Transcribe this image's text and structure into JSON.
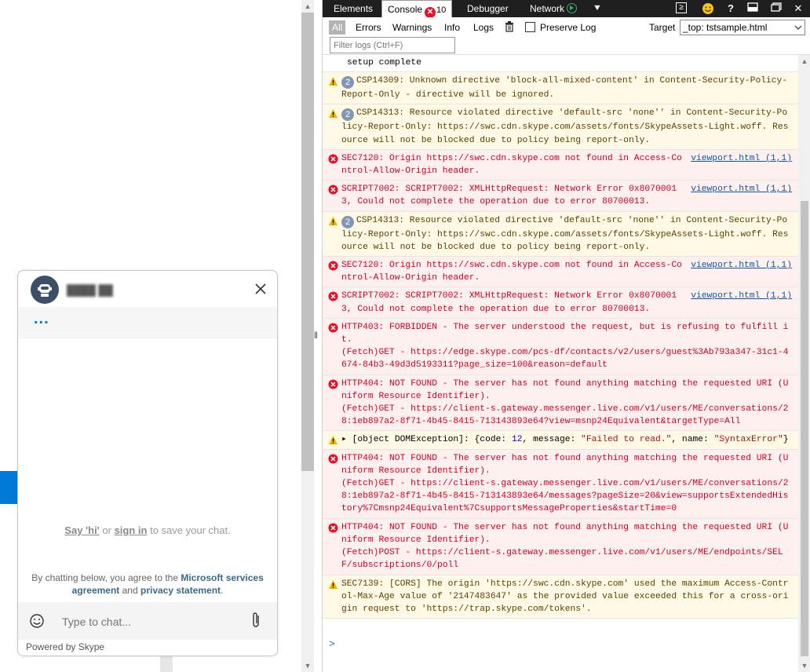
{
  "chat": {
    "name": "████ ██",
    "typing_indicator": "...",
    "say_hi": "Say 'hi'",
    "or": " or ",
    "sign_in": "sign in",
    "save_suffix": " to save your chat.",
    "agree_prefix": "By chatting below, you agree to the ",
    "agreement_link": "Microsoft services agreement",
    "and": " and ",
    "privacy_link": "privacy statement",
    "period": ".",
    "input_placeholder": "Type to chat...",
    "powered_by": "Powered by Skype"
  },
  "devtools": {
    "tabs": {
      "elements": "Elements",
      "console": "Console",
      "error_count": "10",
      "debugger": "Debugger",
      "network": "Network"
    },
    "filters": [
      "All",
      "Errors",
      "Warnings",
      "Info",
      "Logs"
    ],
    "preserve_log": "Preserve Log",
    "target_label": "Target",
    "target_value": "_top: tstsample.html",
    "filter_placeholder": "Filter logs (Ctrl+F)"
  },
  "console": {
    "first_line": "setup complete",
    "messages": [
      {
        "level": "warn",
        "count": "2",
        "text": "CSP14309: Unknown directive 'block-all-mixed-content' in Content-Security-Policy-Report-Only - directive will be ignored.",
        "source": ""
      },
      {
        "level": "warn",
        "count": "2",
        "text": "CSP14313: Resource violated directive 'default-src 'none'' in Content-Security-Policy-Report-Only: https://swc.cdn.skype.com/assets/fonts/SkypeAssets-Light.woff. Resource will not be blocked due to policy being report-only.",
        "source": ""
      },
      {
        "level": "err",
        "count": "",
        "text": "SEC7120: Origin https://swc.cdn.skype.com not found in Access-Control-Allow-Origin header.",
        "source": "viewport.html (1,1)"
      },
      {
        "level": "err",
        "count": "",
        "text": "SCRIPT7002: SCRIPT7002: XMLHttpRequest: Network Error 0x80700013, Could not complete the operation due to error 80700013.",
        "source": "viewport.html (1,1)"
      },
      {
        "level": "warn",
        "count": "2",
        "text": "CSP14313: Resource violated directive 'default-src 'none'' in Content-Security-Policy-Report-Only: https://swc.cdn.skype.com/assets/fonts/SkypeAssets-Light.woff. Resource will not be blocked due to policy being report-only.",
        "source": ""
      },
      {
        "level": "err",
        "count": "",
        "text": "SEC7120: Origin https://swc.cdn.skype.com not found in Access-Control-Allow-Origin header.",
        "source": "viewport.html (1,1)"
      },
      {
        "level": "err",
        "count": "",
        "text": "SCRIPT7002: SCRIPT7002: XMLHttpRequest: Network Error 0x80700013, Could not complete the operation due to error 80700013.",
        "source": "viewport.html (1,1)"
      },
      {
        "level": "err",
        "count": "",
        "text": "HTTP403: FORBIDDEN - The server understood the request, but is refusing to fulfill it.\n(Fetch)GET - https://edge.skype.com/pcs-df/contacts/v2/users/guest%3Ab793a347-31c1-4674-84b3-49d3d5193311?page_size=100&reason=default",
        "source": ""
      },
      {
        "level": "err",
        "count": "",
        "text": "HTTP404: NOT FOUND - The server has not found anything matching the requested URI (Uniform Resource Identifier).\n(Fetch)GET - https://client-s.gateway.messenger.live.com/v1/users/ME/conversations/28:1eb897a2-8f71-4b45-8415-713143893e64?view=msnp24Equivalent&targetType=All",
        "source": ""
      },
      {
        "level": "warn",
        "count": "",
        "object": true,
        "obj_prefix": "[object DOMException]: {",
        "obj_code_key": "code: ",
        "obj_code": "12",
        "obj_msg_key": ", message: ",
        "obj_msg": "\"Failed to read.\"",
        "obj_name_key": ", name: ",
        "obj_name": "\"SyntaxError\"",
        "obj_suffix": "}",
        "text": "",
        "source": ""
      },
      {
        "level": "err",
        "count": "",
        "text": "HTTP404: NOT FOUND - The server has not found anything matching the requested URI (Uniform Resource Identifier).\n(Fetch)GET - https://client-s.gateway.messenger.live.com/v1/users/ME/conversations/28:1eb897a2-8f71-4b45-8415-713143893e64/messages?pageSize=20&view=supportsExtendedHistory%7Cmsnp24Equivalent%7CsupportsMessageProperties&startTime=0",
        "source": ""
      },
      {
        "level": "err",
        "count": "",
        "text": "HTTP404: NOT FOUND - The server has not found anything matching the requested URI (Uniform Resource Identifier).\n(Fetch)POST - https://client-s.gateway.messenger.live.com/v1/users/ME/endpoints/SELF/subscriptions/0/poll",
        "source": ""
      },
      {
        "level": "warn",
        "count": "",
        "text": "SEC7139: [CORS] The origin 'https://swc.cdn.skype.com' used the maximum Access-Control-Max-Age value of '2147483647' as the provided value exceeded this for a cross-origin request to 'https://trap.skype.com/tokens'.",
        "source": ""
      }
    ],
    "prompt": ">"
  },
  "colors": {
    "accent": "#0078d7",
    "error": "#e81123",
    "warning": "#f5b400",
    "link": "#0b56b0"
  },
  "icons": {
    "warning": "warning-icon",
    "error": "error-icon",
    "trash": "trash-icon",
    "smile": "emoji-icon",
    "attach": "paperclip-icon",
    "close": "close-icon"
  }
}
